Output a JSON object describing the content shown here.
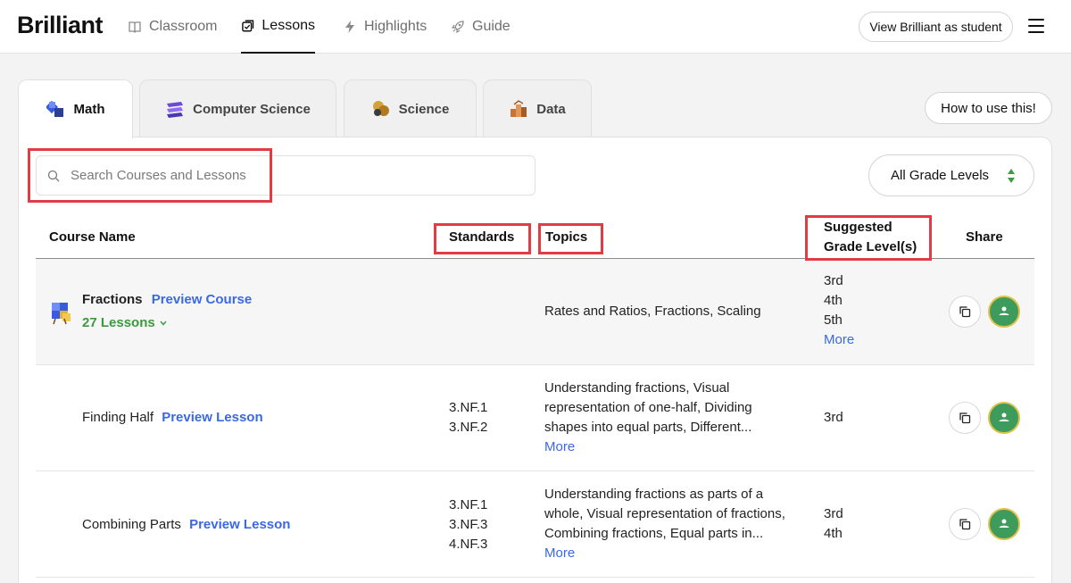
{
  "nav": {
    "logo": "Brilliant",
    "items": [
      {
        "label": "Classroom",
        "icon": "book-icon"
      },
      {
        "label": "Lessons",
        "icon": "lessons-icon"
      },
      {
        "label": "Highlights",
        "icon": "bolt-icon"
      },
      {
        "label": "Guide",
        "icon": "rocket-icon"
      }
    ],
    "student_button": "View Brilliant as student",
    "menu_icon": "hamburger-icon"
  },
  "tabs": [
    {
      "label": "Math",
      "icon": "math-icon"
    },
    {
      "label": "Computer Science",
      "icon": "cs-icon"
    },
    {
      "label": "Science",
      "icon": "science-icon"
    },
    {
      "label": "Data",
      "icon": "data-icon"
    }
  ],
  "how_to_button": "How to use this!",
  "search": {
    "placeholder": "Search Courses and Lessons"
  },
  "grade_filter": {
    "selected": "All Grade Levels"
  },
  "table": {
    "headers": {
      "course_name": "Course Name",
      "standards": "Standards",
      "topics": "Topics",
      "grade_line1": "Suggested",
      "grade_line2": "Grade Level(s)",
      "share": "Share"
    },
    "course": {
      "name": "Fractions",
      "preview": "Preview Course",
      "lessons": "27 Lessons",
      "topics": "Rates and Ratios, Fractions, Scaling",
      "grades": [
        "3rd",
        "4th",
        "5th"
      ],
      "more": "More"
    },
    "lessons": [
      {
        "name": "Finding Half",
        "preview": "Preview Lesson",
        "standards": [
          "3.NF.1",
          "3.NF.2"
        ],
        "topics": [
          "Understanding fractions, Visual",
          "representation of one-half, Dividing",
          "shapes into equal parts, Different..."
        ],
        "topics_more": "More",
        "grades": [
          "3rd"
        ]
      },
      {
        "name": "Combining Parts",
        "preview": "Preview Lesson",
        "standards": [
          "3.NF.1",
          "3.NF.3",
          "4.NF.3"
        ],
        "topics": [
          "Understanding fractions as parts of a",
          "whole, Visual representation of fractions,",
          "Combining fractions, Equal parts in..."
        ],
        "topics_more": "More",
        "grades": [
          "3rd",
          "4th"
        ]
      }
    ]
  },
  "colors": {
    "link": "#3a68e6",
    "lesson_count": "#3a9a3c",
    "highlight_box": "#e03c44",
    "classroom_button": "#3d9b5b"
  }
}
